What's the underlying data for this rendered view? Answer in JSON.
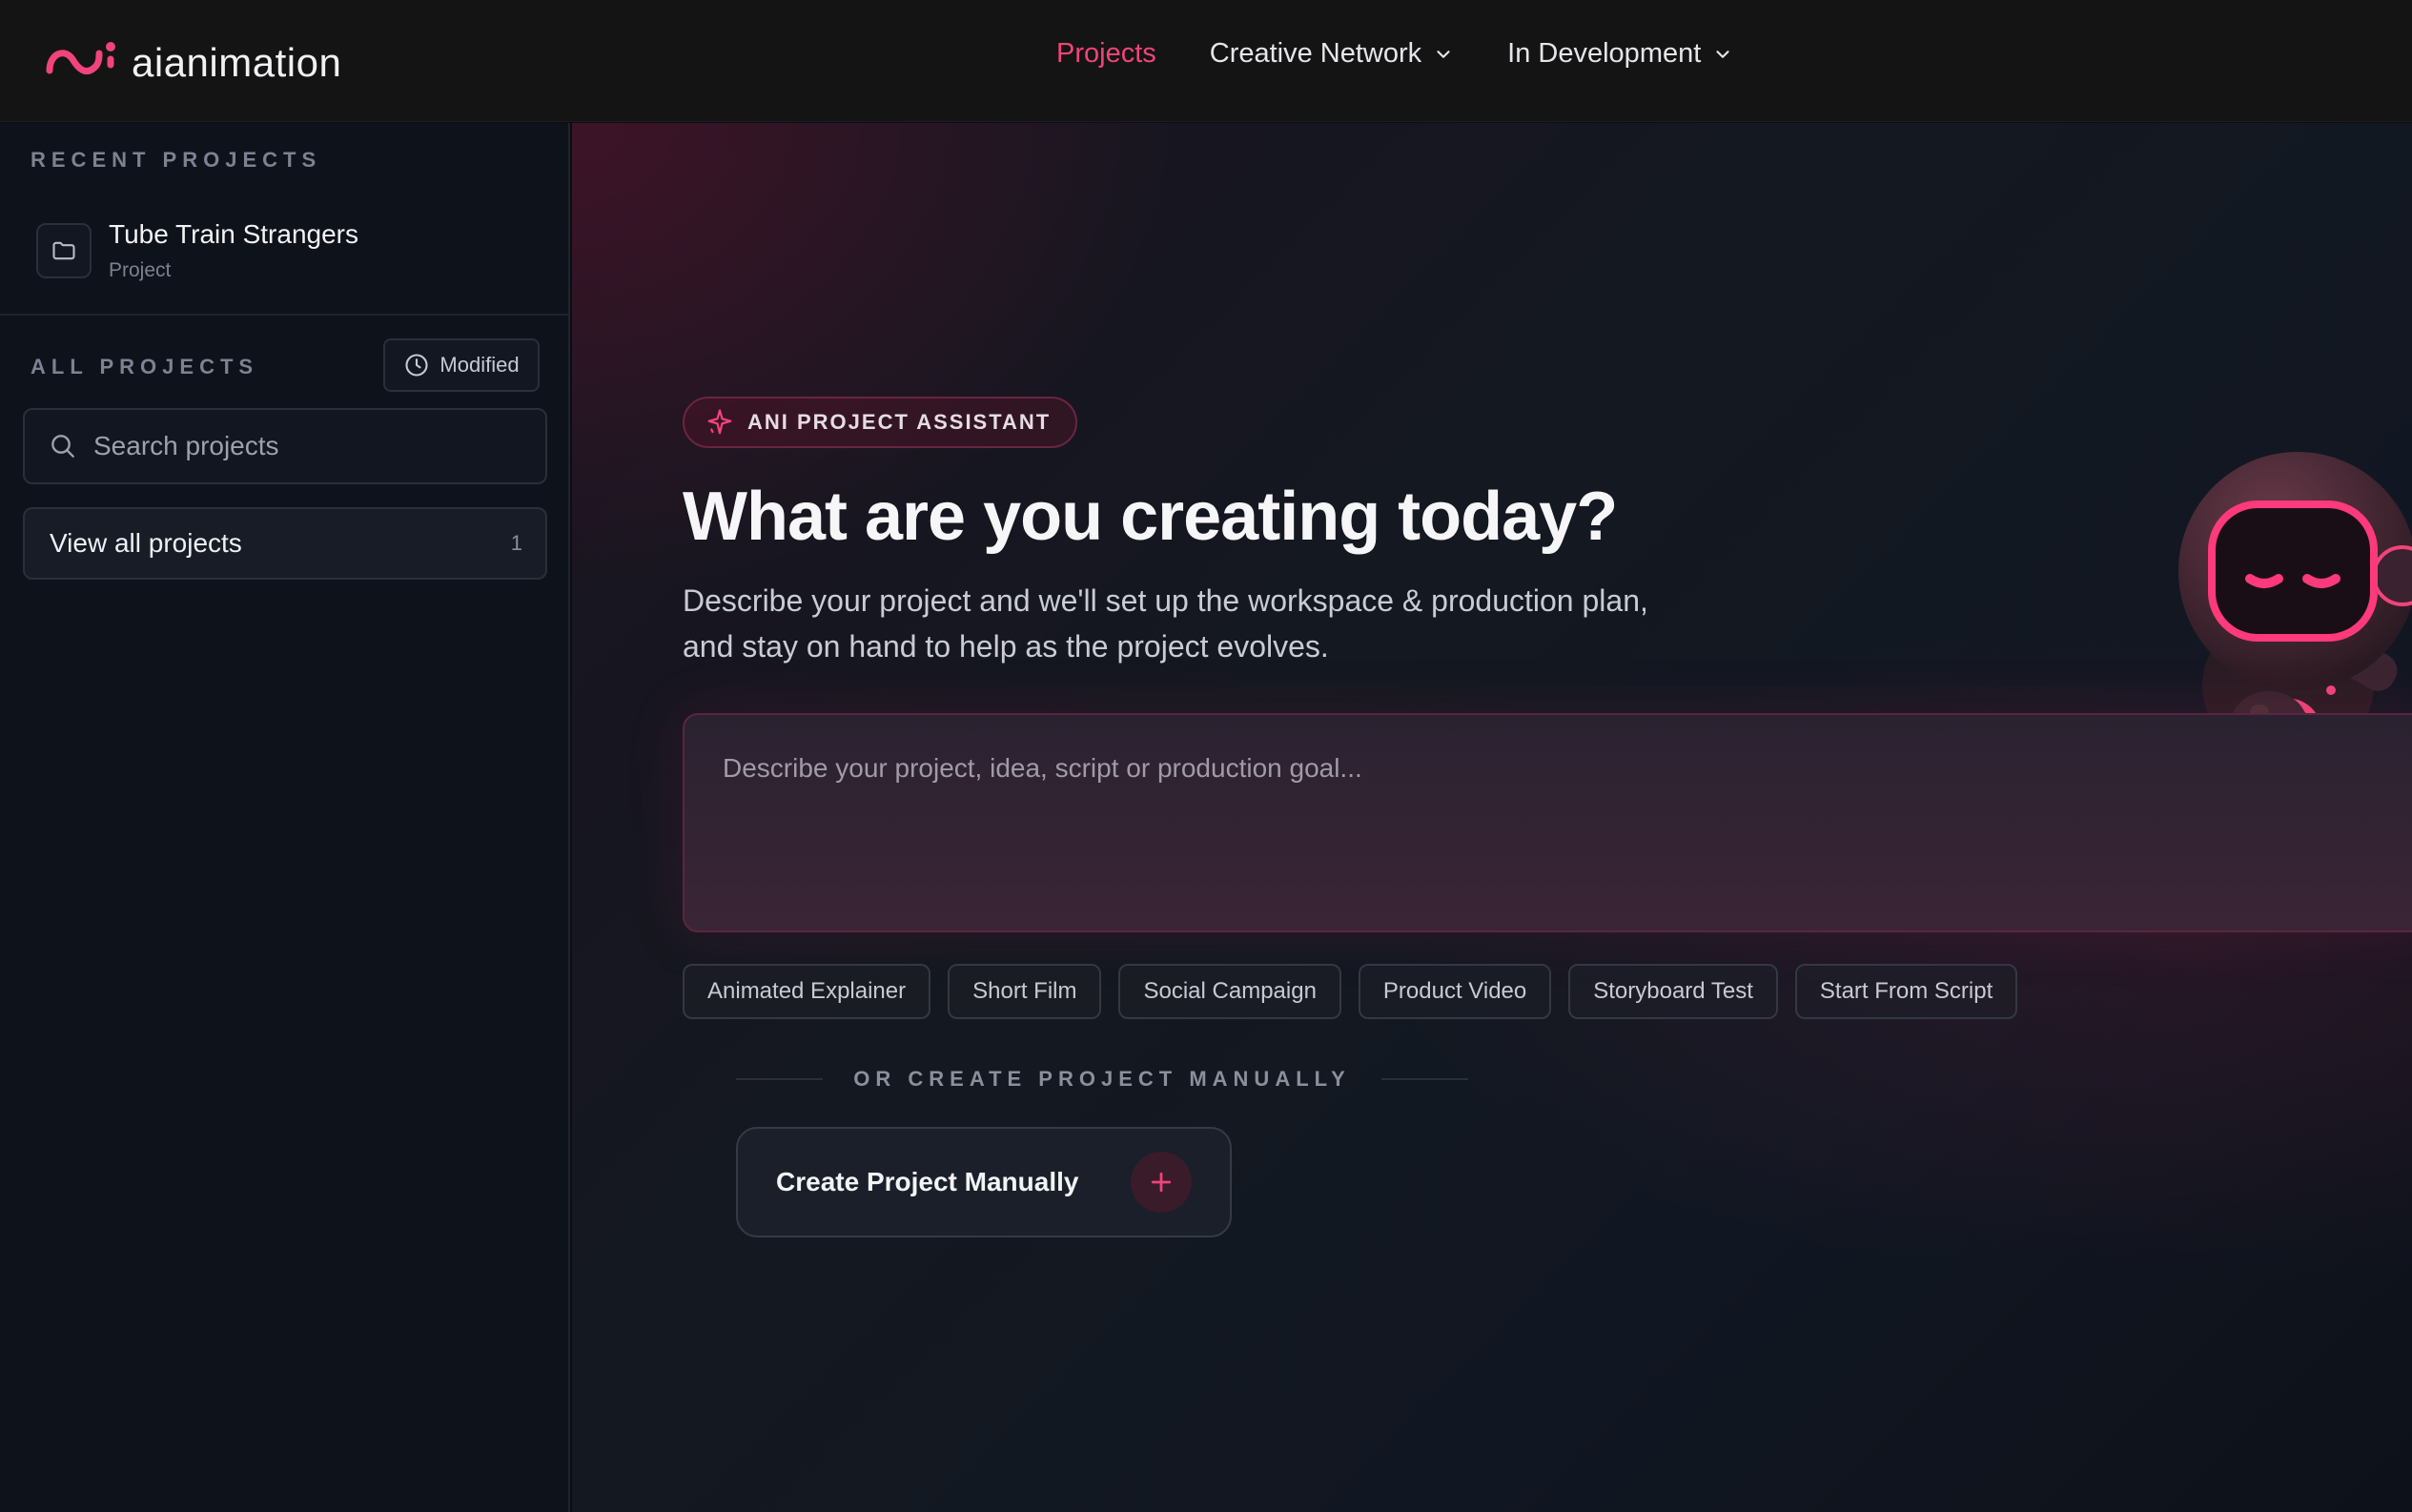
{
  "brand": {
    "name": "aianimation",
    "accent": "#f0447a"
  },
  "nav": {
    "items": [
      {
        "label": "Projects",
        "active": true
      },
      {
        "label": "Creative Network",
        "has_dropdown": true
      },
      {
        "label": "In Development",
        "has_dropdown": true
      }
    ]
  },
  "sidebar": {
    "recent_heading": "RECENT PROJECTS",
    "recent_projects": [
      {
        "title": "Tube Train Strangers",
        "subtitle": "Project",
        "icon": "folder-icon"
      }
    ],
    "all_heading": "ALL PROJECTS",
    "sort_button": {
      "label": "Modified",
      "icon": "clock-icon"
    },
    "search": {
      "placeholder": "Search projects",
      "value": ""
    },
    "view_all": {
      "label": "View all projects",
      "count": "1"
    }
  },
  "main": {
    "badge": "ANI PROJECT ASSISTANT",
    "title": "What are you creating today?",
    "subtitle_line1": "Describe your project and we'll set up the workspace & production plan,",
    "subtitle_line2": "and stay on hand to help as the project evolves.",
    "prompt": {
      "placeholder": "Describe your project, idea, script or production goal...",
      "value": ""
    },
    "chips": [
      "Animated Explainer",
      "Short Film",
      "Social Campaign",
      "Product Video",
      "Storyboard Test",
      "Start From Script"
    ],
    "divider_text": "OR CREATE PROJECT MANUALLY",
    "create_button": "Create Project Manually"
  }
}
